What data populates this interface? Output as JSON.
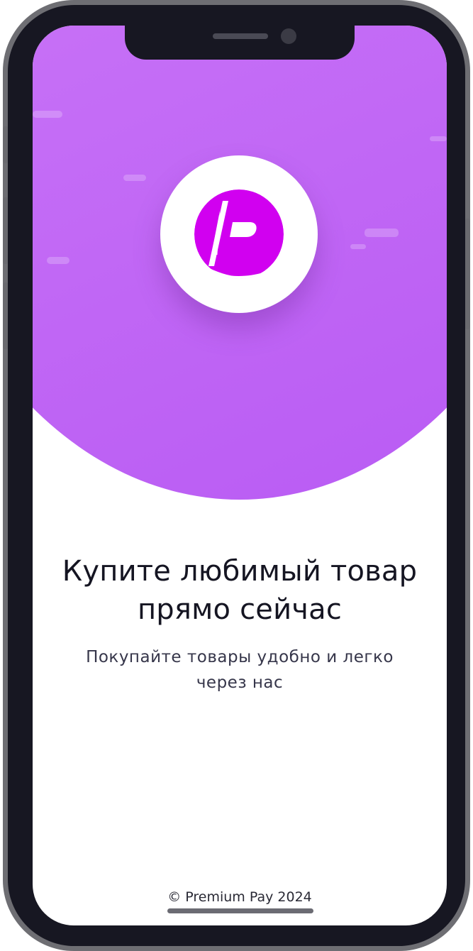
{
  "screen": {
    "headline": [
      "Купите любимый товар",
      "прямо сейчас"
    ],
    "subtitle": [
      "Покупайте товары удобно и легко",
      "через нас"
    ],
    "footer": {
      "copyright": "© Premium Pay 2024"
    }
  },
  "logo": {
    "icon": "premium-pay-p-logo",
    "color": "#d100f0"
  },
  "theme": {
    "hero_gradient": [
      "#d47ef9",
      "#b85af3"
    ],
    "text_color": "#151522",
    "phone_frame": "#171722"
  }
}
